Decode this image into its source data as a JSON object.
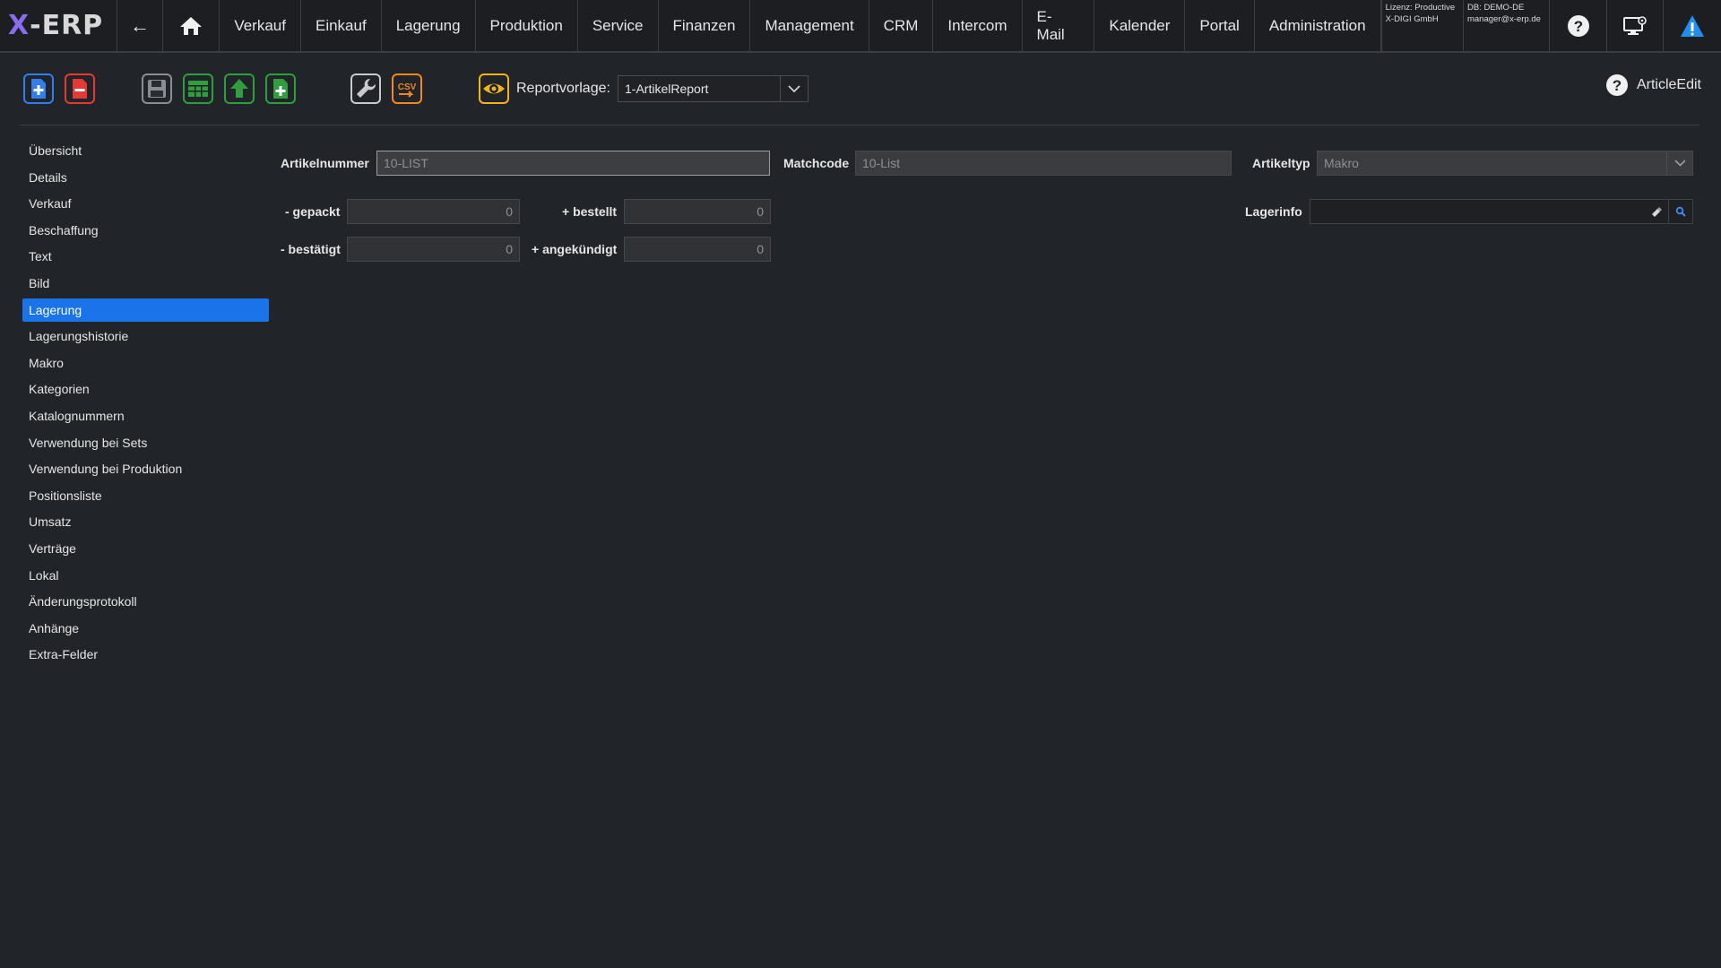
{
  "app": {
    "logo_prefix": "X",
    "logo_rest": "-ERP"
  },
  "nav": {
    "items": [
      "Verkauf",
      "Einkauf",
      "Lagerung",
      "Produktion",
      "Service",
      "Finanzen",
      "Management",
      "CRM",
      "Intercom",
      "E-Mail",
      "Kalender",
      "Portal",
      "Administration"
    ],
    "license_line1": "Lizenz: Productive",
    "license_line2": "X-DIGI GmbH",
    "db_line1": "DB: DEMO-DE",
    "db_line2": "manager@x-erp.de"
  },
  "toolbar": {
    "report_label": "Reportvorlage:",
    "report_value": "1-ArtikelReport",
    "help_title": "ArticleEdit",
    "csv_label": "CSV"
  },
  "sidebar": {
    "items": [
      "Übersicht",
      "Details",
      "Verkauf",
      "Beschaffung",
      "Text",
      "Bild",
      "Lagerung",
      "Lagerungshistorie",
      "Makro",
      "Kategorien",
      "Katalognummern",
      "Verwendung bei Sets",
      "Verwendung bei Produktion",
      "Positionsliste",
      "Umsatz",
      "Verträge",
      "Lokal",
      "Änderungsprotokoll",
      "Anhänge",
      "Extra-Felder"
    ],
    "active_index": 6
  },
  "form": {
    "artikelnummer_label": "Artikelnummer",
    "artikelnummer_value": "10-LIST",
    "matchcode_label": "Matchcode",
    "matchcode_value": "10-List",
    "artikeltyp_label": "Artikeltyp",
    "artikeltyp_value": "Makro",
    "gepackt_label": "- gepackt",
    "gepackt_value": "0",
    "bestellt_label": "+ bestellt",
    "bestellt_value": "0",
    "bestaetigt_label": "- bestätigt",
    "bestaetigt_value": "0",
    "angekuendigt_label": "+ angekündigt",
    "angekuendigt_value": "0",
    "lagerinfo_label": "Lagerinfo",
    "lagerinfo_value": ""
  },
  "colors": {
    "accent": "#1a73e8",
    "background": "#212428",
    "topbar": "#1c1e22"
  }
}
